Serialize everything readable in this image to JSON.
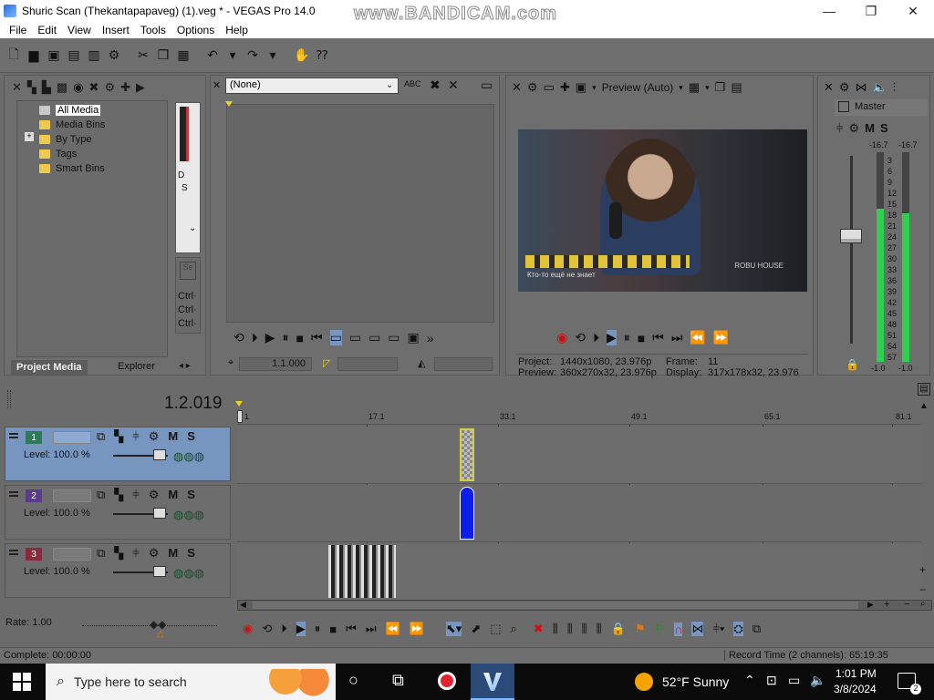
{
  "window": {
    "title": "Shuric Scan (Thekantapapaveg) (1).veg * - VEGAS Pro 14.0",
    "watermark": "www.BANDICAM.com",
    "min": "—",
    "max": "❐",
    "close": "✕"
  },
  "menu": [
    "File",
    "Edit",
    "View",
    "Insert",
    "Tools",
    "Options",
    "Help"
  ],
  "explorer": {
    "items": [
      "All Media",
      "Media Bins",
      "By Type",
      "Tags",
      "Smart Bins"
    ],
    "expand_glyph": "+",
    "tabs": [
      "Project Media",
      "Explorer"
    ],
    "side_letters": [
      "D",
      "S"
    ],
    "side_ctrl": [
      "Ctrl·",
      "Ctrl·",
      "Ctrl·"
    ]
  },
  "trimmer": {
    "dropdown": "(None)",
    "timecode": "1.1.000"
  },
  "preview": {
    "mode": "Preview (Auto)",
    "project_label": "Project:",
    "project_value": "1440x1080, 23.976p",
    "preview_label": "Preview:",
    "preview_value": "360x270x32, 23.976p",
    "frame_label": "Frame:",
    "frame_value": "11",
    "display_label": "Display:",
    "display_value": "317x178x32, 23.976",
    "video_caption": "Кто-то ещё не знает",
    "video_logo": "ROBU HOUSE"
  },
  "mixer": {
    "title": "Master",
    "m": "M",
    "s": "S",
    "peak_left": "-16.7",
    "peak_right": "-16.7",
    "scale": [
      "3",
      "6",
      "9",
      "12",
      "15",
      "18",
      "21",
      "24",
      "27",
      "30",
      "33",
      "36",
      "39",
      "42",
      "45",
      "48",
      "51",
      "54",
      "57"
    ],
    "bottom_left": "-1.0",
    "bottom_right": "-1.0",
    "level_left": 0.73,
    "level_right": 0.71
  },
  "timeline": {
    "position": "1.2.019",
    "ruler": [
      "1",
      "17.1",
      "33.1",
      "49.1",
      "65.1",
      "81.1"
    ],
    "tracks": [
      {
        "num": "1",
        "level": "Level: 100.0 %",
        "m": "M",
        "s": "S"
      },
      {
        "num": "2",
        "level": "Level: 100.0 %",
        "m": "M",
        "s": "S"
      },
      {
        "num": "3",
        "level": "Level: 100.0 %",
        "m": "M",
        "s": "S"
      }
    ]
  },
  "rate": "Rate: 1.00",
  "status": {
    "complete": "Complete: 00:00:00",
    "record_time": "Record Time (2 channels): 65:19:35"
  },
  "taskbar": {
    "search_placeholder": "Type here to search",
    "weather": "52°F  Sunny",
    "time": "1:01 PM",
    "date": "3/8/2024",
    "notifications": "2"
  }
}
